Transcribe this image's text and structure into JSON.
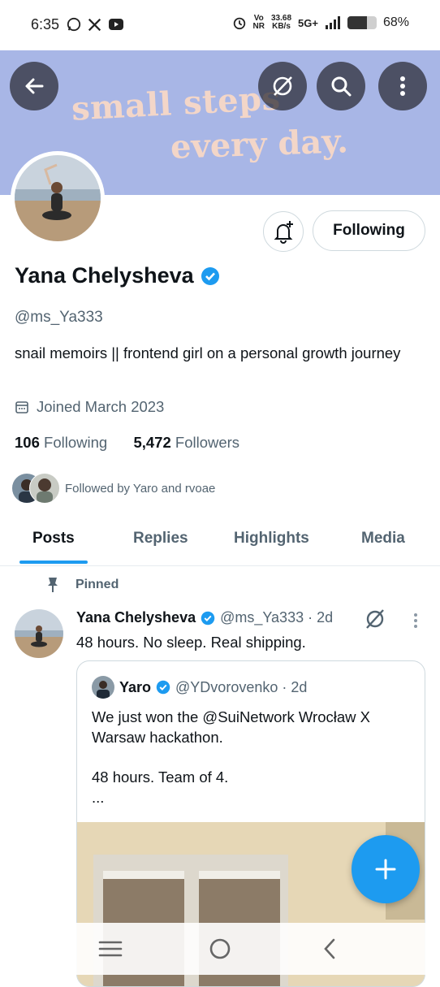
{
  "status_bar": {
    "time": "6:35",
    "speed_top": "33.68",
    "speed_bottom": "KB/s",
    "volte_top": "Vo",
    "volte_bottom": "NR",
    "network": "5G+",
    "battery": "68%",
    "battery_level": 0.68
  },
  "banner": {
    "line1": "small steps",
    "line2": "every day.",
    "bg_color": "#a8b6e6",
    "text_color": "#f3d6c8"
  },
  "header_buttons": [
    "back-arrow-icon",
    "grok-icon",
    "search-icon",
    "more-vertical-icon"
  ],
  "profile": {
    "follow_button": "Following",
    "name": "Yana Chelysheva",
    "handle": "@ms_Ya333",
    "bio": "snail memoirs || frontend girl on a personal growth journey",
    "joined": "Joined March 2023",
    "following_count": "106",
    "following_label": "Following",
    "followers_count": "5,472",
    "followers_label": "Followers",
    "followed_by": "Followed by Yaro and rvoae"
  },
  "tabs": [
    "Posts",
    "Replies",
    "Highlights",
    "Media"
  ],
  "active_tab": "Posts",
  "pinned_post": {
    "pinned_label": "Pinned",
    "author_name": "Yana Chelysheva",
    "author_handle_time": "@ms_Ya333 · 2d",
    "text": "48 hours. No sleep. Real shipping.",
    "quote": {
      "author_name": "Yaro",
      "author_handle_time": "@YDvorovenko · 2d",
      "line1": "We just won the @SuiNetwork Wrocław X Warsaw hackathon.",
      "line2": "48 hours. Team of 4.",
      "line3": "..."
    }
  },
  "accent_color": "#1d9bf0",
  "verified_color": "#1d9bf0"
}
